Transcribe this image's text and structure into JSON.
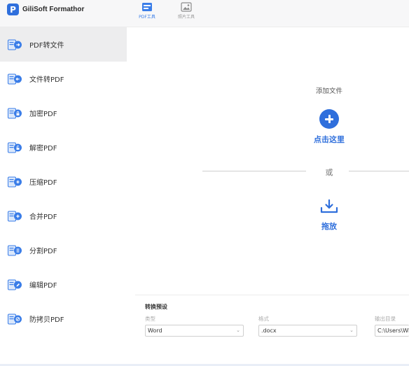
{
  "app": {
    "logo_letter": "P",
    "title": "GiliSoft Formathor"
  },
  "top_tabs": [
    {
      "label": "PDF工具",
      "icon": "pdf-tools-icon",
      "active": true
    },
    {
      "label": "照片工具",
      "icon": "photo-tools-icon",
      "active": false
    }
  ],
  "sidebar": {
    "items": [
      {
        "label": "PDF转文件",
        "icon": "pdf-to-file-icon",
        "active": true
      },
      {
        "label": "文件转PDF",
        "icon": "file-to-pdf-icon"
      },
      {
        "label": "加密PDF",
        "icon": "encrypt-pdf-icon"
      },
      {
        "label": "解密PDF",
        "icon": "decrypt-pdf-icon"
      },
      {
        "label": "压缩PDF",
        "icon": "compress-pdf-icon"
      },
      {
        "label": "合并PDF",
        "icon": "merge-pdf-icon"
      },
      {
        "label": "分割PDF",
        "icon": "split-pdf-icon"
      },
      {
        "label": "编辑PDF",
        "icon": "edit-pdf-icon"
      },
      {
        "label": "防拷贝PDF",
        "icon": "copy-protect-pdf-icon"
      }
    ]
  },
  "main": {
    "add_title": "添加文件",
    "click_here": "点击这里",
    "or": "或",
    "drag_drop": "拖放"
  },
  "presets": {
    "title": "转换预设",
    "type_label": "类型",
    "type_value": "Word",
    "format_label": "格式",
    "format_value": ".docx",
    "output_label": "输出目录",
    "output_value": "C:\\Users\\WD"
  },
  "colors": {
    "accent": "#2f6fdc",
    "sidebar_active": "#ededee",
    "header_bg": "#f7f7f8"
  }
}
